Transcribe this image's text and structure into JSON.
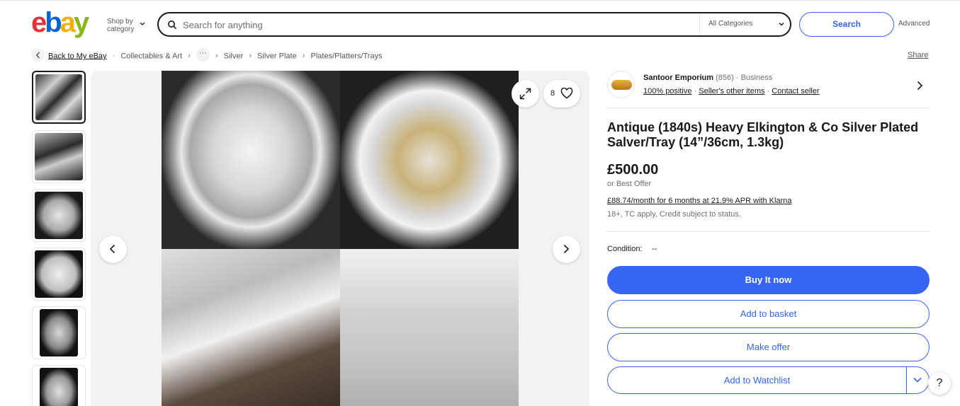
{
  "header": {
    "logo": [
      "e",
      "b",
      "a",
      "y"
    ],
    "logo_colors": [
      "#e53238",
      "#0064d2",
      "#f5af02",
      "#86b817"
    ],
    "shop_by_line1": "Shop by",
    "shop_by_line2": "category",
    "search_placeholder": "Search for anything",
    "category_select": "All Categories",
    "search_button": "Search",
    "advanced_link": "Advanced"
  },
  "breadcrumb": {
    "items": [
      "Back to My eBay",
      "Collectables & Art",
      "Silver",
      "Silver Plate",
      "Plates/Platters/Trays"
    ],
    "share": "Share"
  },
  "gallery": {
    "watch_count": "8",
    "thumbnail_count": 6
  },
  "seller": {
    "name": "Santoor Emporium",
    "feedback_count": "(856)",
    "type": "Business",
    "positive": "100% positive",
    "other_items": "Seller's other items",
    "contact": "Contact seller"
  },
  "listing": {
    "title": "Antique (1840s) Heavy Elkington & Co Silver Plated Salver/Tray (14”/36cm, 1.3kg)",
    "price": "£500.00",
    "best_offer": "or Best Offer",
    "klarna": "£88.74/month for 6 months at 21.9% APR with Klarna",
    "terms": "18+, TC apply, Credit subject to status.",
    "condition_label": "Condition:",
    "condition_value": "--"
  },
  "actions": {
    "buy_now": "Buy It now",
    "add_basket": "Add to basket",
    "make_offer": "Make offer",
    "watchlist": "Add to Watchlist",
    "help": "?"
  },
  "colors": {
    "accent": "#3665f3",
    "text": "#191919",
    "muted": "#707070"
  }
}
